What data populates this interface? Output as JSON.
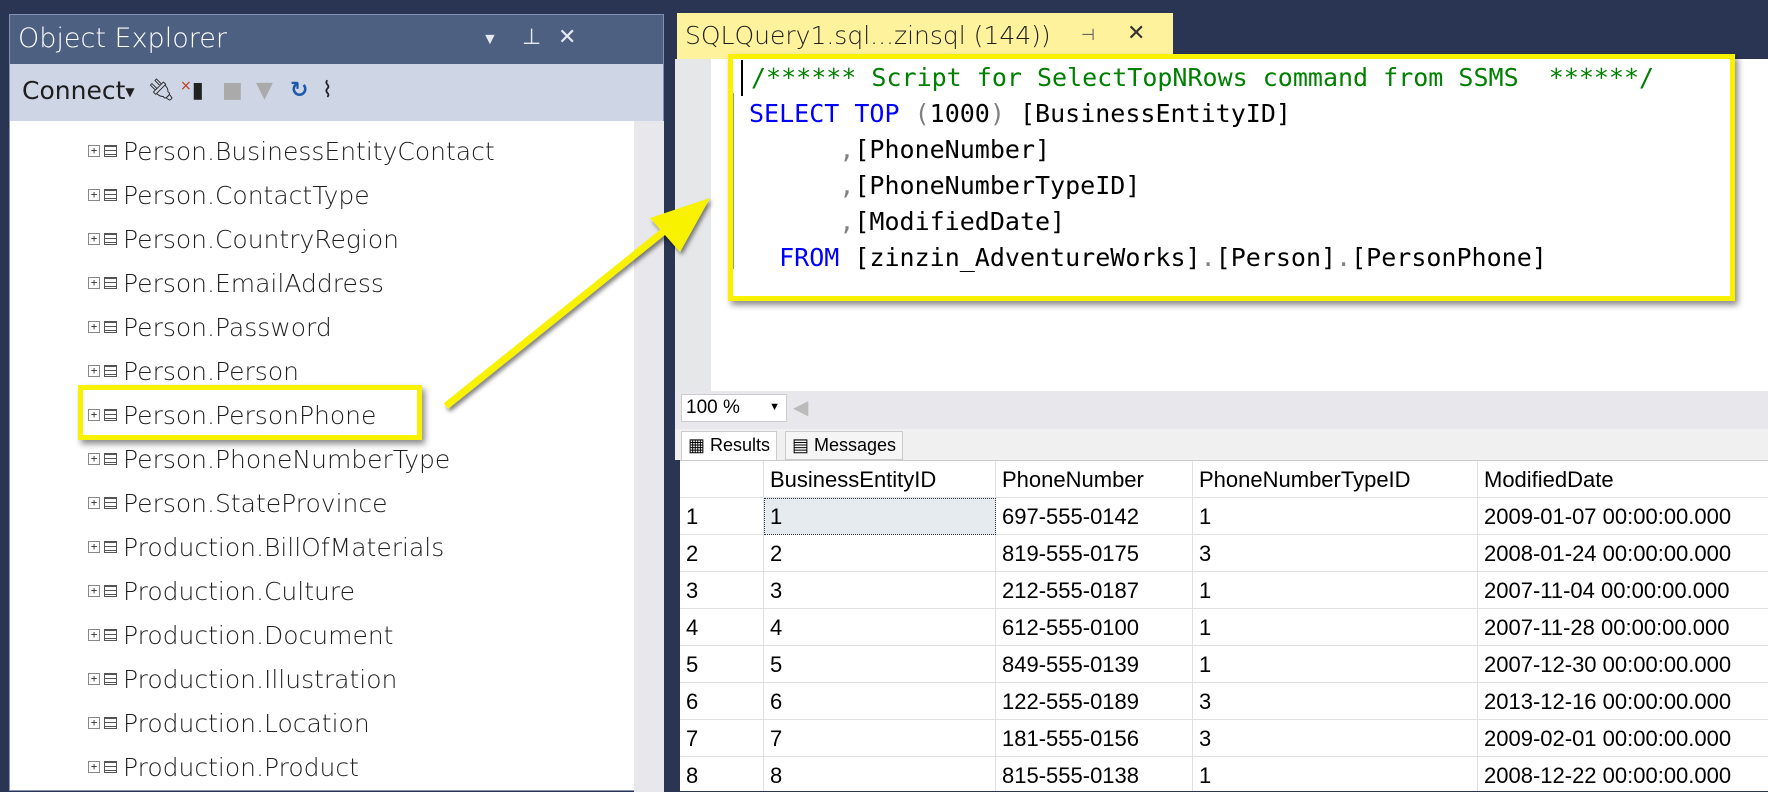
{
  "object_explorer": {
    "title": "Object Explorer",
    "connect_label": "Connect",
    "dropdown_icon": "▼",
    "pin_icon": "pin",
    "close_icon": "✕",
    "tree_items": [
      "Person.BusinessEntityContact",
      "Person.ContactType",
      "Person.CountryRegion",
      "Person.EmailAddress",
      "Person.Password",
      "Person.Person",
      "Person.PersonPhone",
      "Person.PhoneNumberType",
      "Person.StateProvince",
      "Production.BillOfMaterials",
      "Production.Culture",
      "Production.Document",
      "Production.Illustration",
      "Production.Location",
      "Production.Product"
    ],
    "highlighted_item": "Person.PersonPhone"
  },
  "editor": {
    "tab_title": "SQLQuery1.sql...zinsql (144))",
    "lines": {
      "comment": "/****** Script for SelectTopNRows command from SSMS  ******/",
      "select_kw": "SELECT",
      "top_kw": "TOP",
      "top_open": "(",
      "top_n": "1000",
      "top_close": ")",
      "col1": "[BusinessEntityID]",
      "comma": ",",
      "col2": "[PhoneNumber]",
      "col3": "[PhoneNumberTypeID]",
      "col4": "[ModifiedDate]",
      "from_kw": "FROM",
      "db": "[zinzin_AdventureWorks]",
      "dot": ".",
      "schema": "[Person]",
      "table": "[PersonPhone]"
    }
  },
  "results": {
    "zoom": "100 %",
    "tabs": [
      "Results",
      "Messages"
    ],
    "columns": [
      "",
      "BusinessEntityID",
      "PhoneNumber",
      "PhoneNumberTypeID",
      "ModifiedDate"
    ],
    "rows": [
      [
        "1",
        "1",
        "697-555-0142",
        "1",
        "2009-01-07 00:00:00.000"
      ],
      [
        "2",
        "2",
        "819-555-0175",
        "3",
        "2008-01-24 00:00:00.000"
      ],
      [
        "3",
        "3",
        "212-555-0187",
        "1",
        "2007-11-04 00:00:00.000"
      ],
      [
        "4",
        "4",
        "612-555-0100",
        "1",
        "2007-11-28 00:00:00.000"
      ],
      [
        "5",
        "5",
        "849-555-0139",
        "1",
        "2007-12-30 00:00:00.000"
      ],
      [
        "6",
        "6",
        "122-555-0189",
        "3",
        "2013-12-16 00:00:00.000"
      ],
      [
        "7",
        "7",
        "181-555-0156",
        "3",
        "2009-02-01 00:00:00.000"
      ],
      [
        "8",
        "8",
        "815-555-0138",
        "1",
        "2008-12-22 00:00:00.000"
      ]
    ]
  },
  "colors": {
    "highlight": "#f8f200",
    "tab": "#fff29d",
    "keyword": "#0000ff",
    "comment": "#008000",
    "frame": "#293552"
  }
}
